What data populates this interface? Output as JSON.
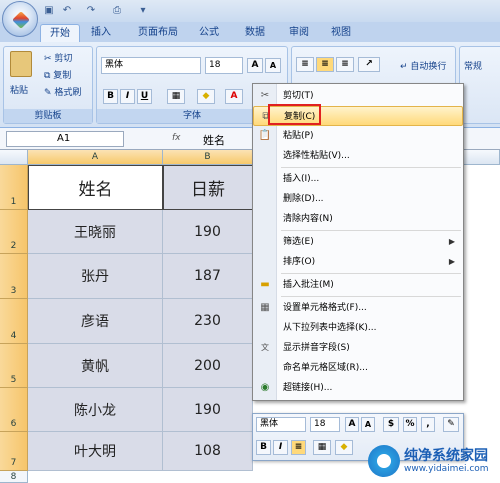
{
  "qat": {
    "icons": [
      "save-icon",
      "undo-icon",
      "redo-icon",
      "print-preview-icon",
      "dropdown-icon"
    ]
  },
  "tabs": [
    "开始",
    "插入",
    "页面布局",
    "公式",
    "数据",
    "审阅",
    "视图"
  ],
  "ribbon": {
    "clipboard": {
      "paste": "粘贴",
      "cut": "剪切",
      "copy": "复制",
      "format_painter": "格式刷",
      "title": "剪贴板"
    },
    "font": {
      "name": "黑体",
      "size": "18",
      "bold": "B",
      "italic": "I",
      "underline": "U",
      "grow": "A",
      "shrink": "A",
      "title": "字体"
    },
    "alignment": {
      "wrap": "自动换行"
    },
    "number": {
      "format": "常规"
    }
  },
  "formula_bar": {
    "cell_ref": "A1",
    "fx": "fx",
    "content": "姓名"
  },
  "columns": [
    "A",
    "B"
  ],
  "rows": [
    "1",
    "2",
    "3",
    "4",
    "5",
    "6",
    "7",
    "8"
  ],
  "table": {
    "headers": [
      "姓名",
      "日薪"
    ],
    "rows": [
      [
        "王晓丽",
        "190"
      ],
      [
        "张丹",
        "187"
      ],
      [
        "彦语",
        "230"
      ],
      [
        "黄帆",
        "200"
      ],
      [
        "陈小龙",
        "190"
      ],
      [
        "叶大明",
        "108"
      ]
    ]
  },
  "context_menu": [
    {
      "label": "剪切(T)",
      "icon": "scissors-icon"
    },
    {
      "label": "复制(C)",
      "icon": "copy-icon",
      "highlighted": true
    },
    {
      "label": "粘贴(P)",
      "icon": "paste-icon"
    },
    {
      "label": "选择性粘贴(V)..."
    },
    {
      "label": "插入(I)..."
    },
    {
      "label": "删除(D)..."
    },
    {
      "label": "清除内容(N)"
    },
    {
      "label": "筛选(E)",
      "submenu": true
    },
    {
      "label": "排序(O)",
      "submenu": true
    },
    {
      "label": "插入批注(M)",
      "icon": "comment-icon"
    },
    {
      "label": "设置单元格格式(F)...",
      "icon": "format-cells-icon"
    },
    {
      "label": "从下拉列表中选择(K)..."
    },
    {
      "label": "显示拼音字段(S)",
      "icon": "phonetic-icon"
    },
    {
      "label": "命名单元格区域(R)..."
    },
    {
      "label": "超链接(H)...",
      "icon": "hyperlink-icon"
    }
  ],
  "mini_toolbar": {
    "font": "黑体",
    "size": "18",
    "percent": "%",
    "comma": ",",
    "bold": "B",
    "italic": "I"
  },
  "watermark": {
    "title": "纯净系统家园",
    "url": "www.yidaimei.com"
  }
}
